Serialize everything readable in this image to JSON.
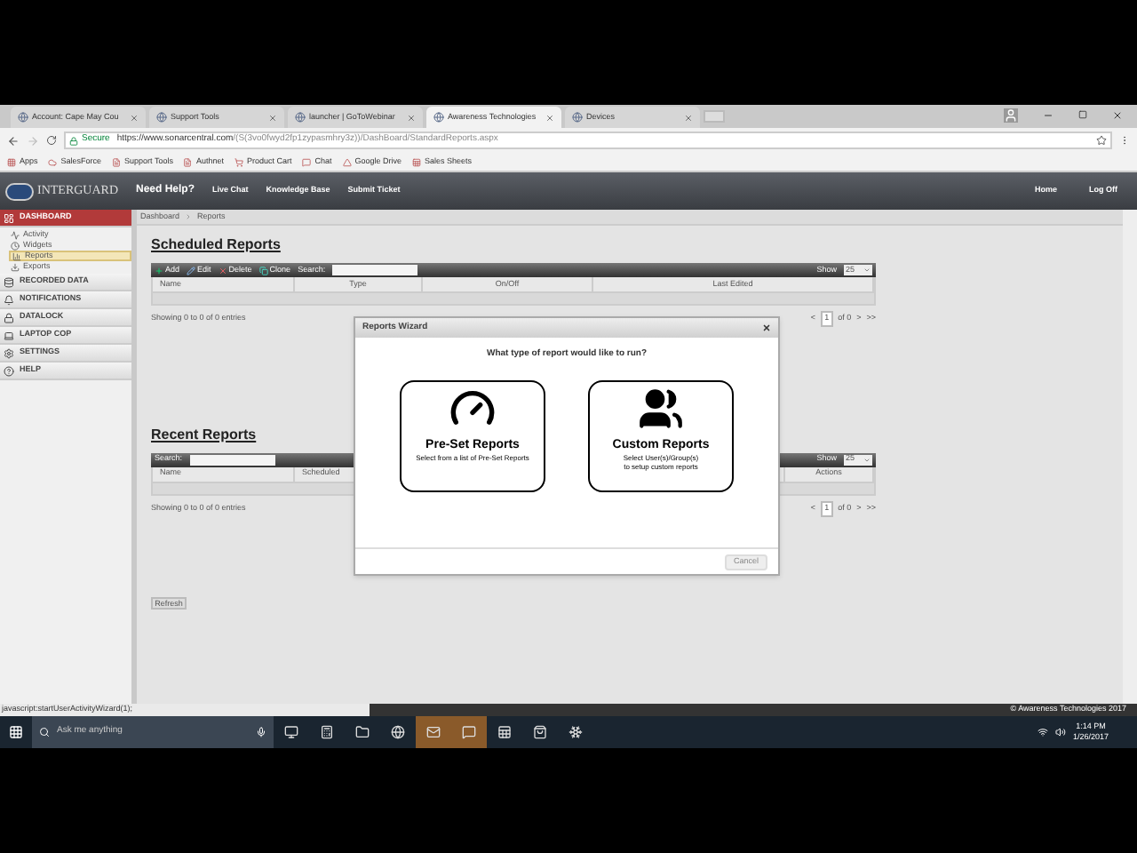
{
  "browser": {
    "tabs": [
      {
        "label": "Account: Cape May Cou",
        "selected": false
      },
      {
        "label": "Support Tools",
        "selected": false
      },
      {
        "label": "launcher | GoToWebinar",
        "selected": false
      },
      {
        "label": "Awareness Technologies",
        "selected": true
      },
      {
        "label": "Devices",
        "selected": false
      }
    ],
    "secure_label": "Secure",
    "url_host": "https://www.sonarcentral.com",
    "url_path": "/(S(3vo0fwyd2fp1zypasmhry3z))/DashBoard/StandardReports.aspx",
    "bookmarks": [
      "Apps",
      "SalesForce",
      "Support Tools",
      "Authnet",
      "Product Cart",
      "Chat",
      "Google Drive",
      "Sales Sheets"
    ]
  },
  "app": {
    "logo": "INTERGUARD",
    "help_title": "Need Help?",
    "help_links": [
      "Live Chat",
      "Knowledge Base",
      "Submit Ticket"
    ],
    "nav": [
      "Home",
      "Log Off"
    ]
  },
  "sidebar": {
    "sections": [
      {
        "label": "DASHBOARD",
        "selected": true,
        "children": [
          {
            "label": "Activity",
            "selected": false
          },
          {
            "label": "Widgets",
            "selected": false
          },
          {
            "label": "Reports",
            "selected": true
          },
          {
            "label": "Exports",
            "selected": false
          }
        ]
      },
      {
        "label": "RECORDED DATA",
        "selected": false
      },
      {
        "label": "NOTIFICATIONS",
        "selected": false
      },
      {
        "label": "DATALOCK",
        "selected": false
      },
      {
        "label": "LAPTOP COP",
        "selected": false
      },
      {
        "label": "SETTINGS",
        "selected": false
      },
      {
        "label": "HELP",
        "selected": false
      }
    ]
  },
  "breadcrumb": [
    "Dashboard",
    "Reports"
  ],
  "tables": [
    {
      "title": "Scheduled Reports",
      "actions": [
        "Add",
        "Edit",
        "Delete",
        "Clone"
      ],
      "search_label": "Search:",
      "show_label": "Show",
      "page_size": "25",
      "columns": [
        "Name",
        "Type",
        "On/Off",
        "Last Edited"
      ],
      "info": "Showing 0 to 0 of 0 entries",
      "pager": [
        "<",
        "1",
        "of 0",
        ">",
        ">>"
      ]
    },
    {
      "title": "Recent Reports",
      "search_label": "Search:",
      "show_label": "Show",
      "page_size": "25",
      "columns": [
        "Name",
        "Scheduled",
        "Actions"
      ],
      "info": "Showing 0 to 0 of 0 entries",
      "pager": [
        "<",
        "1",
        "of 0",
        ">",
        ">>"
      ]
    }
  ],
  "refresh": "Refresh",
  "dialog": {
    "title": "Reports Wizard",
    "question": "What type of report would like to run?",
    "options": [
      {
        "kind": "preset",
        "title": "Pre-Set Reports",
        "description": [
          "Select from a list of Pre-Set Reports"
        ]
      },
      {
        "kind": "custom",
        "title": "Custom Reports",
        "description": [
          "Select User(s)/Group(s)",
          "to setup custom reports"
        ]
      }
    ],
    "cancel": "Cancel"
  },
  "status_text": "javascript:startUserActivityWizard(1);",
  "footer": "© Awareness Technologies 2017",
  "taskbar": {
    "search_placeholder": "Ask me anything",
    "time": "1:14 PM",
    "date": "1/26/2017"
  }
}
